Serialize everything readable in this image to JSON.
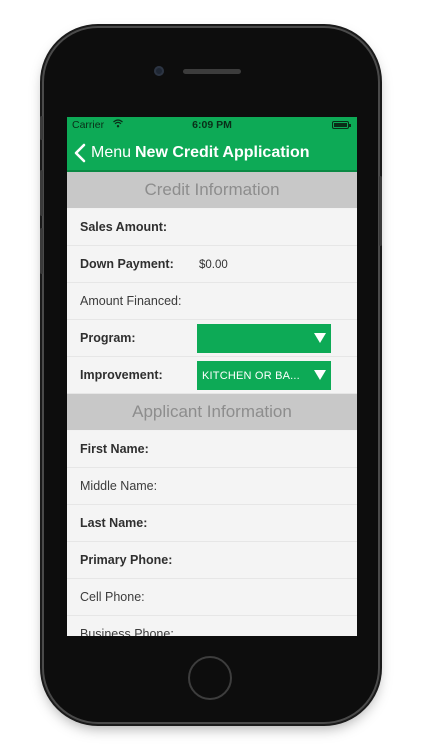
{
  "status_bar": {
    "carrier": "Carrier",
    "time": "6:09 PM"
  },
  "nav": {
    "back_label": "Menu",
    "title": "New Credit Application"
  },
  "credit_section": {
    "header": "Credit Information",
    "sales_amount_label": "Sales Amount:",
    "sales_amount_value": "",
    "down_payment_label": "Down Payment:",
    "down_payment_value": "$0.00",
    "amount_financed_label": "Amount Financed:",
    "amount_financed_value": "",
    "program_label": "Program:",
    "program_value": "",
    "improvement_label": "Improvement:",
    "improvement_value": "KITCHEN OR BA..."
  },
  "applicant_section": {
    "header": "Applicant Information",
    "first_name_label": "First Name:",
    "middle_name_label": "Middle Name:",
    "last_name_label": "Last Name:",
    "primary_phone_label": "Primary Phone:",
    "cell_phone_label": "Cell Phone:",
    "business_phone_label": "Business Phone:"
  },
  "colors": {
    "brand_green": "#0daa56",
    "section_gray": "#c8c8c8",
    "phone_body": "#0d0d0d"
  }
}
